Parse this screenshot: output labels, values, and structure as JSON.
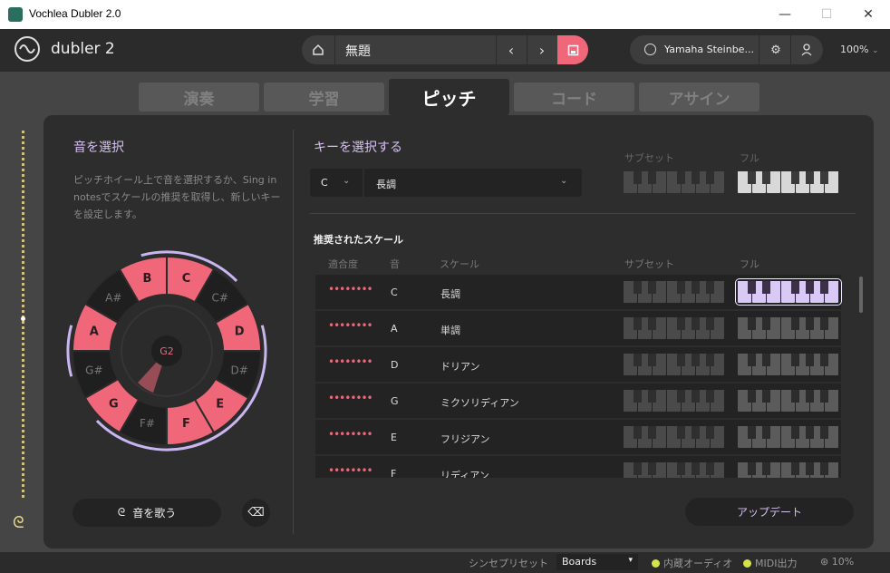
{
  "window": {
    "title": "Vochlea Dubler 2.0",
    "minimize": "—",
    "maximize": "☐",
    "close": "✕"
  },
  "header": {
    "logo_text": "dubler 2",
    "project_name": "無題",
    "prev": "‹",
    "next": "›",
    "device_name": "Yamaha Steinbe...",
    "zoom": "100%",
    "zoom_chevron": "⌄"
  },
  "tabs": [
    "演奏",
    "学習",
    "ピッチ",
    "コード",
    "アサイン"
  ],
  "active_tab": "ピッチ",
  "note_select": {
    "title": "音を選択",
    "description": "ピッチホイール上で音を選択するか、Sing in notesでスケールの推奨を取得し、新しいキーを設定します。",
    "center_note": "G2",
    "wheel_notes": [
      "C",
      "C#",
      "D",
      "D#",
      "E",
      "F",
      "F#",
      "G",
      "G#",
      "A",
      "A#",
      "B"
    ],
    "selected_notes": [
      "C",
      "D",
      "E",
      "F",
      "G",
      "A",
      "B"
    ],
    "sing_button": "音を歌う"
  },
  "key_select": {
    "title": "キーを選択する",
    "key": "C",
    "scale": "長調",
    "subset_label": "サブセット",
    "full_label": "フル"
  },
  "recommended": {
    "title": "推奨されたスケール",
    "columns": [
      "適合度",
      "音",
      "スケール",
      "サブセット",
      "フル"
    ],
    "rows": [
      {
        "fit": "••••••••",
        "note": "C",
        "scale": "長調",
        "selected": true
      },
      {
        "fit": "••••••••",
        "note": "A",
        "scale": "単調",
        "selected": false
      },
      {
        "fit": "••••••••",
        "note": "D",
        "scale": "ドリアン",
        "selected": false
      },
      {
        "fit": "••••••••",
        "note": "G",
        "scale": "ミクソリディアン",
        "selected": false
      },
      {
        "fit": "••••••••",
        "note": "E",
        "scale": "フリジアン",
        "selected": false
      },
      {
        "fit": "••••••••",
        "note": "F",
        "scale": "リディアン",
        "selected": false
      }
    ],
    "update_button": "アップデート"
  },
  "footer": {
    "synth_preset_label": "シンセプリセット",
    "preset": "Boards",
    "preset_chevron": "▾",
    "internal_audio": "内蔵オーディオ",
    "midi_out": "MIDI出力",
    "cpu": "10%"
  },
  "colors": {
    "accent": "#f0677a",
    "lavender": "#c9b6f0",
    "led": "#d5e24a"
  }
}
